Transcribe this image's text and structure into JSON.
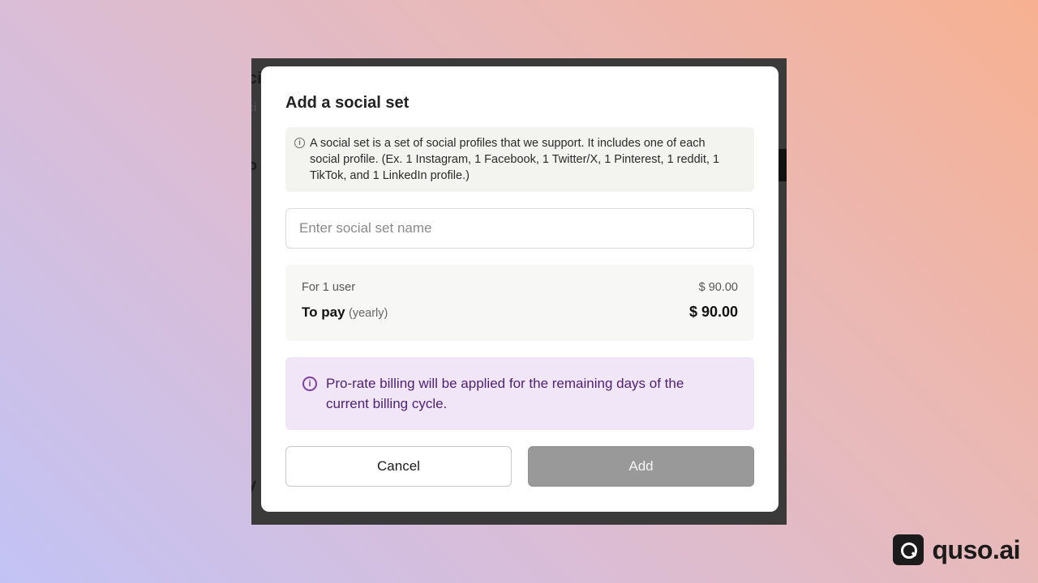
{
  "background_fragments": {
    "f1": "ci",
    "f2": "ci",
    "f3": "o",
    "f4": "y"
  },
  "modal": {
    "title": "Add a social set",
    "info_text": "A social set is a set of social profiles that we support. It includes one of each social profile. (Ex. 1 Instagram, 1 Facebook, 1 Twitter/X, 1 Pinterest, 1 reddit, 1 TikTok, and 1 LinkedIn profile.)",
    "name_input": {
      "placeholder": "Enter social set name",
      "value": ""
    },
    "pricing": {
      "per_user_label": "For 1 user",
      "per_user_amount": "$ 90.00",
      "total_label": "To pay",
      "total_period": "(yearly)",
      "total_amount": "$ 90.00"
    },
    "notice_text": "Pro-rate billing will be applied for the remaining days of the current billing cycle.",
    "buttons": {
      "cancel": "Cancel",
      "add": "Add"
    }
  },
  "brand": {
    "name": "quso.ai"
  },
  "icons": {
    "info": "info-icon",
    "notice": "info-circle-icon"
  },
  "colors": {
    "notice_bg": "#f1e6f8",
    "notice_text": "#4d1f73",
    "add_disabled": "#999999"
  }
}
